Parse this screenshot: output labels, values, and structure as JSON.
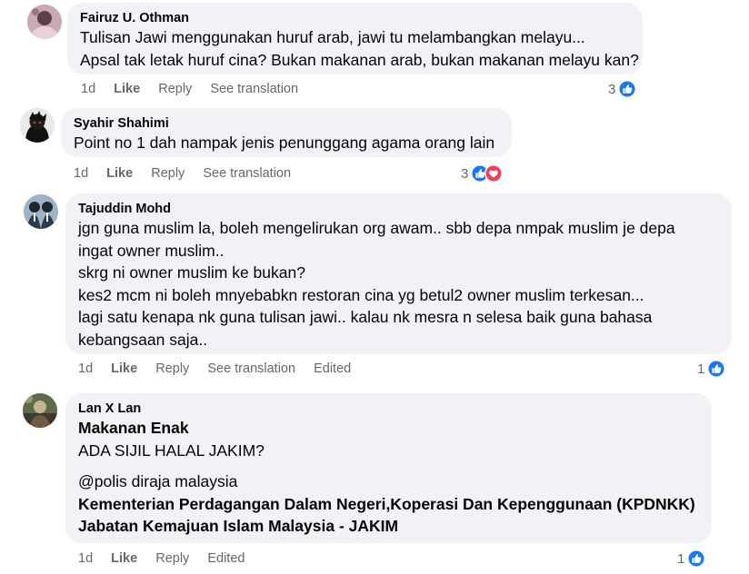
{
  "comments": [
    {
      "author": "Fairuz U. Othman",
      "lines": [
        "Tulisan Jawi menggunakan huruf arab, jawi tu melambangkan melayu...",
        "Apsal tak letak huruf cina? Bukan makanan arab, bukan makanan melayu kan?"
      ],
      "time": "1d",
      "like_label": "Like",
      "reply_label": "Reply",
      "translate_label": "See translation",
      "reaction_count": "3",
      "reactions": [
        "like-icon"
      ]
    },
    {
      "author": "Syahir Shahimi",
      "lines": [
        "Point no 1 dah nampak jenis penunggang agama orang lain"
      ],
      "time": "1d",
      "like_label": "Like",
      "reply_label": "Reply",
      "translate_label": "See translation",
      "reaction_count": "3",
      "reactions": [
        "like-icon",
        "love-icon"
      ]
    },
    {
      "author": "Tajuddin Mohd",
      "lines": [
        "jgn guna muslim la, boleh mengelirukan org awam.. sbb depa nmpak muslim je depa",
        "ingat owner muslim..",
        "skrg ni owner muslim ke bukan?",
        "kes2 mcm ni boleh mnyebabkn restoran cina yg betul2 owner muslim terkesan...",
        "lagi satu kenapa nk guna tulisan jawi.. kalau nk mesra n selesa baik guna bahasa",
        "kebangsaan saja.."
      ],
      "time": "1d",
      "like_label": "Like",
      "reply_label": "Reply",
      "translate_label": "See translation",
      "edited_label": "Edited",
      "reaction_count": "1",
      "reactions": [
        "like-icon"
      ]
    },
    {
      "author": "Lan X Lan",
      "lines": [
        "Makanan Enak",
        "ADA SIJIL HALAL JAKIM?",
        "@polis diraja malaysia",
        "Kementerian Perdagangan Dalam Negeri,Koperasi Dan Kepenggunaan (KPDNKK)",
        "Jabatan Kemajuan Islam Malaysia - JAKIM"
      ],
      "time": "1d",
      "like_label": "Like",
      "reply_label": "Reply",
      "edited_label": "Edited",
      "reaction_count": "1",
      "reactions": [
        "like-icon"
      ]
    }
  ],
  "colors": {
    "bubble": "#f0f2f5",
    "meta_text": "#65676b",
    "like_blue": "#1877f2",
    "love_red": "#f33e58"
  }
}
